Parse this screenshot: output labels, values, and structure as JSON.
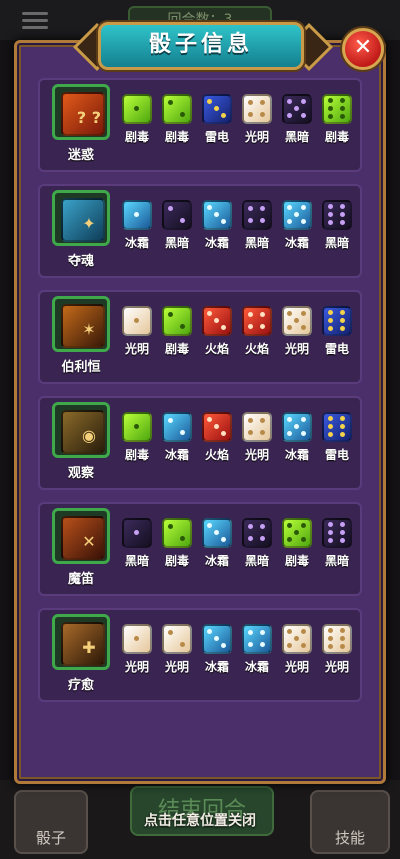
{
  "background": {
    "round_label": "回合数：3",
    "end_turn_label": "结束回合",
    "dice_button_label": "骰子",
    "skills_button_label": "技能"
  },
  "dialog": {
    "title": "骰子信息",
    "close_icon": "close-icon",
    "hint": "点击任意位置关闭"
  },
  "skills": [
    {
      "name": "迷惑",
      "icon": "confuse-dice-icon",
      "glyph": "? ?",
      "dice": [
        {
          "type": "poison",
          "label": "剧毒",
          "pips": 1
        },
        {
          "type": "poison",
          "label": "剧毒",
          "pips": 2
        },
        {
          "type": "thunder",
          "label": "雷电",
          "pips": 3
        },
        {
          "type": "light",
          "label": "光明",
          "pips": 4
        },
        {
          "type": "dark",
          "label": "黑暗",
          "pips": 5
        },
        {
          "type": "poison",
          "label": "剧毒",
          "pips": 6
        }
      ]
    },
    {
      "name": "夺魂",
      "icon": "soul-dice-icon",
      "glyph": "✦",
      "dice": [
        {
          "type": "ice",
          "label": "冰霜",
          "pips": 1
        },
        {
          "type": "dark",
          "label": "黑暗",
          "pips": 2
        },
        {
          "type": "ice",
          "label": "冰霜",
          "pips": 3
        },
        {
          "type": "dark",
          "label": "黑暗",
          "pips": 4
        },
        {
          "type": "ice",
          "label": "冰霜",
          "pips": 5
        },
        {
          "type": "dark",
          "label": "黑暗",
          "pips": 6
        }
      ]
    },
    {
      "name": "伯利恒",
      "icon": "star-dice-icon",
      "glyph": "✶",
      "dice": [
        {
          "type": "light",
          "label": "光明",
          "pips": 1
        },
        {
          "type": "poison",
          "label": "剧毒",
          "pips": 2
        },
        {
          "type": "fire",
          "label": "火焰",
          "pips": 3
        },
        {
          "type": "fire",
          "label": "火焰",
          "pips": 4
        },
        {
          "type": "light",
          "label": "光明",
          "pips": 5
        },
        {
          "type": "thunder",
          "label": "雷电",
          "pips": 6
        }
      ]
    },
    {
      "name": "观察",
      "icon": "eye-dice-icon",
      "glyph": "◉",
      "dice": [
        {
          "type": "poison",
          "label": "剧毒",
          "pips": 1
        },
        {
          "type": "ice",
          "label": "冰霜",
          "pips": 2
        },
        {
          "type": "fire",
          "label": "火焰",
          "pips": 3
        },
        {
          "type": "light",
          "label": "光明",
          "pips": 4
        },
        {
          "type": "ice",
          "label": "冰霜",
          "pips": 5
        },
        {
          "type": "thunder",
          "label": "雷电",
          "pips": 6
        }
      ]
    },
    {
      "name": "魔笛",
      "icon": "flute-dice-icon",
      "glyph": "✕",
      "dice": [
        {
          "type": "dark",
          "label": "黑暗",
          "pips": 1
        },
        {
          "type": "poison",
          "label": "剧毒",
          "pips": 2
        },
        {
          "type": "ice",
          "label": "冰霜",
          "pips": 3
        },
        {
          "type": "dark",
          "label": "黑暗",
          "pips": 4
        },
        {
          "type": "poison",
          "label": "剧毒",
          "pips": 5
        },
        {
          "type": "dark",
          "label": "黑暗",
          "pips": 6
        }
      ]
    },
    {
      "name": "疗愈",
      "icon": "heal-dice-icon",
      "glyph": "✚",
      "dice": [
        {
          "type": "light",
          "label": "光明",
          "pips": 1
        },
        {
          "type": "light",
          "label": "光明",
          "pips": 2
        },
        {
          "type": "ice",
          "label": "冰霜",
          "pips": 3
        },
        {
          "type": "ice",
          "label": "冰霜",
          "pips": 4
        },
        {
          "type": "light",
          "label": "光明",
          "pips": 5
        },
        {
          "type": "light",
          "label": "光明",
          "pips": 6
        }
      ]
    }
  ]
}
